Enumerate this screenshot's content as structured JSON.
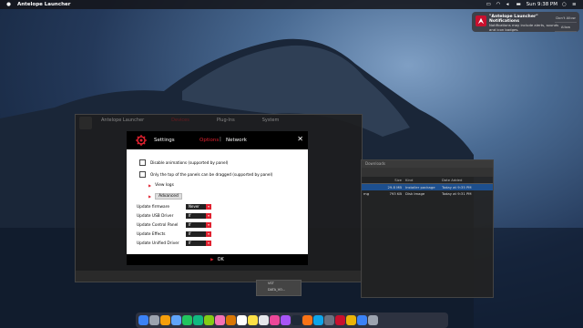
{
  "menubar": {
    "app_name": "Antelope Launcher",
    "clock": "Sun 9:38 PM"
  },
  "notification": {
    "title": "\"Antelope Launcher\" Notifications",
    "body": "Notifications may include alerts, sounds and icon badges.",
    "dont_allow": "Don't Allow",
    "allow": "Allow"
  },
  "bg_window": {
    "title": "Antelope Launcher",
    "tabs": [
      "Devices",
      "Plug-Ins",
      "System"
    ]
  },
  "finder": {
    "path": "Downloads",
    "headers": {
      "size": "Size",
      "kind": "Kind",
      "date": "Date Added"
    },
    "rows": [
      {
        "name": "",
        "size": "29.8 MB",
        "kind": "Installer package",
        "date": "Today at 9:35 PM"
      },
      {
        "name": "mg",
        "size": "793 KB",
        "kind": "Disk Image",
        "date": "Today at 9:31 PM"
      }
    ],
    "drives": [
      "VST",
      "DATA_VO..."
    ]
  },
  "dialog": {
    "title": "Settings",
    "tab_options": "Options",
    "tab_separator": "|",
    "tab_network": "Network",
    "close": "✕",
    "checkbox_animations": "Disable animations (supported by panel)",
    "checkbox_drag": "Only the top of the panels can be dragged (supported by panel)",
    "view_logs": "View logs",
    "advanced": "Advanced",
    "updates": [
      {
        "label": "Update firmware",
        "value": "Never"
      },
      {
        "label": "Update USB Driver",
        "value": "If newer"
      },
      {
        "label": "Update Control Panel",
        "value": "If newer"
      },
      {
        "label": "Update Effects",
        "value": "If newer"
      },
      {
        "label": "Update Unified Driver",
        "value": "If newer"
      }
    ],
    "ok": "OK"
  },
  "colors": {
    "accent": "#e0212f",
    "dialog_header": "#000000"
  }
}
